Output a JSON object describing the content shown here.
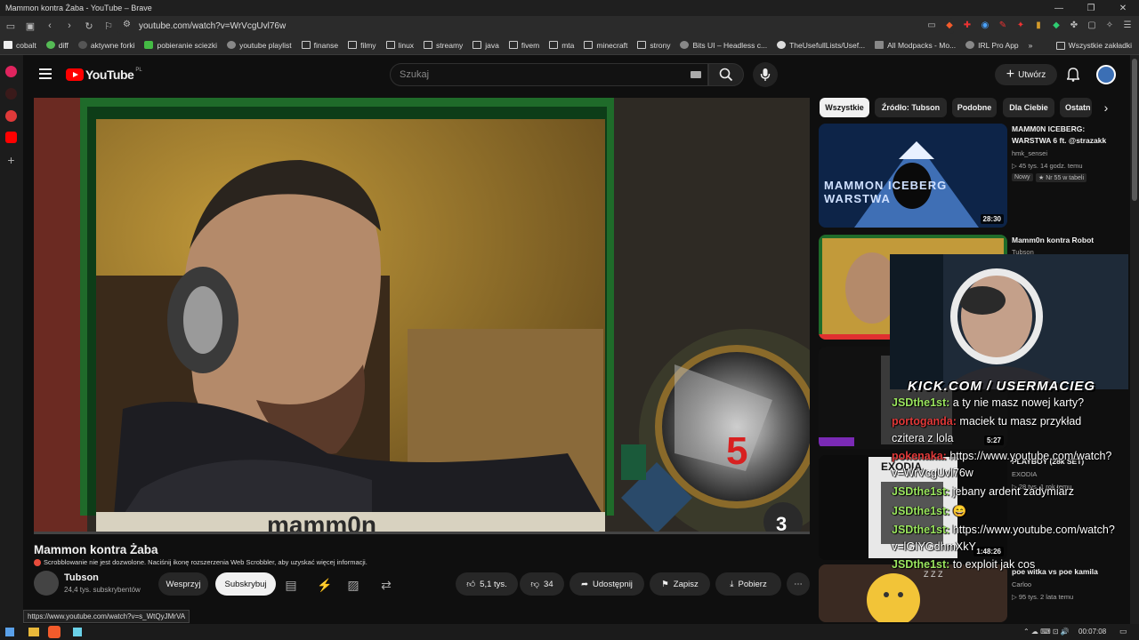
{
  "window": {
    "title": "Mammon kontra Żaba - YouTube – Brave"
  },
  "browser": {
    "url": "youtube.com/watch?v=WrVcgUvl76w"
  },
  "bookmarks": [
    {
      "label": "cobalt",
      "icon": "cobalt-icon"
    },
    {
      "label": "diff",
      "icon": "diff-icon"
    },
    {
      "label": "aktywne forki",
      "icon": "fork-icon"
    },
    {
      "label": "pobieranie sciezki",
      "icon": "download-icon"
    },
    {
      "label": "youtube playlist",
      "icon": "globe-icon"
    },
    {
      "label": "finanse",
      "icon": "folder-icon"
    },
    {
      "label": "filmy",
      "icon": "folder-icon"
    },
    {
      "label": "linux",
      "icon": "folder-icon"
    },
    {
      "label": "streamy",
      "icon": "folder-icon"
    },
    {
      "label": "java",
      "icon": "folder-icon"
    },
    {
      "label": "fivem",
      "icon": "folder-icon"
    },
    {
      "label": "mta",
      "icon": "folder-icon"
    },
    {
      "label": "minecraft",
      "icon": "folder-icon"
    },
    {
      "label": "strony",
      "icon": "folder-icon"
    },
    {
      "label": "Bits UI – Headless c...",
      "icon": "globe-icon"
    },
    {
      "label": "TheUsefullLists/Usef...",
      "icon": "github-icon"
    },
    {
      "label": "All Modpacks - Mo...",
      "icon": "modpack-icon"
    },
    {
      "label": "IRL Pro App",
      "icon": "globe-icon"
    }
  ],
  "bookmarks_all": "Wszystkie zakładki",
  "youtube": {
    "logo": "YouTube",
    "region": "PL",
    "search_placeholder": "Szukaj",
    "create_label": "Utwórz"
  },
  "video": {
    "title": "Mammon kontra Żaba",
    "scrobble_notice": "Scrobblowanie nie jest dozwolone. Naciśnij ikonę rozszerzenia Web Scrobbler, aby uzyskać więcej informacji.",
    "channel_name": "Tubson",
    "channel_subs": "24,4 tys. subskrybentów",
    "support_label": "Wesprzyj",
    "subscribe_label": "Subskrybuj",
    "likes": "5,1 tys.",
    "dislikes": "34",
    "share_label": "Udostępnij",
    "save_label": "Zapisz",
    "download_label": "Pobierz",
    "overlay_text": "mamm0n",
    "overlay_number": "5",
    "overlay_number2": "3"
  },
  "chips": [
    "Wszystkie",
    "Źródło: Tubson",
    "Podobne",
    "Dla Ciebie",
    "Ostatn"
  ],
  "recommendations": [
    {
      "title": "MAMM0N ICEBERG: WARSTWA 6 ft. @strazakk",
      "channel": "hmk_sensei",
      "meta": "▷ 45 tys.   14 godz. temu",
      "badge1": "Nowy",
      "badge2": "★ Nr 55 w tabeli",
      "duration": "28:30",
      "thumb_text": "MAMMON ICEBERG WARSTWA"
    },
    {
      "title": "Mamm0n kontra Robot",
      "channel": "Tubson"
    },
    {
      "title": "",
      "duration": "5:27"
    },
    {
      "title": "PLAYBOY (28k SET)",
      "channel": "EXODIA",
      "meta": "▷ 28 tys.   1 rok temu",
      "duration": "1:48:26",
      "thumb_text": "EXODIA"
    },
    {
      "title": "poe witka vs poe kamila",
      "channel": "Carloo",
      "meta": "▷ 95 tys.   2 lata temu",
      "thumb_text": "Z Z Z"
    }
  ],
  "stream_overlay": {
    "kick_text": "KICK.COM / USERMACIEG",
    "chat": [
      {
        "nick": "JSDthe1st:",
        "msg": "a ty nie masz nowej karty?",
        "color": "green"
      },
      {
        "nick": "portoganda:",
        "msg": "maciek tu masz przykład",
        "color": "red"
      },
      {
        "nick": "",
        "msg": "czitera z lola",
        "color": "green"
      },
      {
        "nick": "pokenaka:",
        "msg": "https://www.youtube.com/watch?",
        "color": "red"
      },
      {
        "nick": "",
        "msg": "v=WrVcgUvl76w",
        "color": "green"
      },
      {
        "nick": "JSDthe1st:",
        "msg": "jebany ardent zadymiarz",
        "color": "green"
      },
      {
        "nick": "JSDthe1st:",
        "msg": "😄",
        "color": "green"
      },
      {
        "nick": "JSDthe1st:",
        "msg": "https://www.youtube.com/watch?",
        "color": "green"
      },
      {
        "nick": "",
        "msg": "v=lGIYGdhmXkY",
        "color": "green"
      },
      {
        "nick": "JSDthe1st:",
        "msg": "to exploit jak cos",
        "color": "green"
      }
    ]
  },
  "status_url": "https://www.youtube.com/watch?v=s_WtQyJMrVA",
  "taskbar": {
    "time": "00:07:08"
  },
  "colors": {
    "bg": "#0f0f0f",
    "accent": "#ff0000",
    "chat_nick": "#9be65f"
  }
}
